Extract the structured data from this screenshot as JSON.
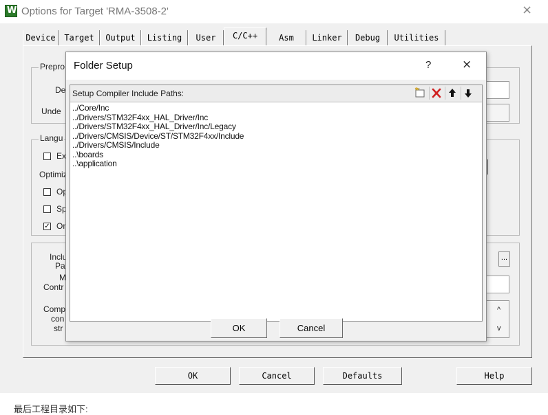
{
  "window": {
    "title": "Options for Target 'RMA-3508-2'",
    "app_icon_letter": "W",
    "close_glyph": "×"
  },
  "tabs": [
    {
      "label": "Device"
    },
    {
      "label": "Target"
    },
    {
      "label": "Output"
    },
    {
      "label": "Listing"
    },
    {
      "label": "User"
    },
    {
      "label": "C/C++",
      "active": true
    },
    {
      "label": "Asm"
    },
    {
      "label": "Linker"
    },
    {
      "label": "Debug"
    },
    {
      "label": "Utilities"
    }
  ],
  "background_fragments": {
    "preprocessor_group": "Prepro",
    "define_label": "De",
    "undefine_label": "Unde",
    "language_group": "Langu",
    "execute_only_fragment": "Ex",
    "optimization_label": "Optimiz",
    "opt1_fragment": "Op",
    "opt2_fragment": "Sp",
    "opt3_fragment": "On",
    "include_label_1": "Inclu",
    "include_label_2": "Pa",
    "misc_label_1": "M",
    "misc_label_2": "Contr",
    "compiler_label_1": "Comp",
    "compiler_label_2": "con",
    "compiler_label_3": "str",
    "browse_button": "...",
    "up_arrow": "^",
    "down_arrow": "v"
  },
  "bottom_buttons": {
    "ok": "OK",
    "cancel": "Cancel",
    "defaults": "Defaults",
    "help": "Help"
  },
  "folder_setup": {
    "title": "Folder Setup",
    "help_glyph": "?",
    "close_glyph": "×",
    "list_header": "Setup Compiler Include Paths:",
    "toolbar_icons": [
      "new-folder-icon",
      "delete-icon",
      "move-up-icon",
      "move-down-icon"
    ],
    "paths": [
      "../Core/Inc",
      "../Drivers/STM32F4xx_HAL_Driver/Inc",
      "../Drivers/STM32F4xx_HAL_Driver/Inc/Legacy",
      "../Drivers/CMSIS/Device/ST/STM32F4xx/Include",
      "../Drivers/CMSIS/Include",
      "..\\boards",
      "..\\application"
    ],
    "ok_label": "OK",
    "cancel_label": "Cancel"
  },
  "caption": "最后工程目录如下:",
  "colors": {
    "delete_icon": "#d02020",
    "app_icon": "#2c7a2a",
    "dialog_bg": "#f0f0f0"
  }
}
